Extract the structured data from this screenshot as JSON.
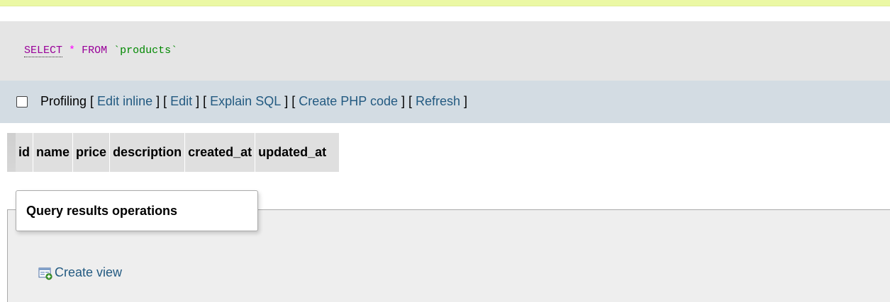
{
  "sql_query": {
    "select_keyword": "SELECT",
    "star": "*",
    "from_keyword": "FROM",
    "table_name": "`products`"
  },
  "toolbar": {
    "profiling_label": "Profiling",
    "profiling_checked": false,
    "links": [
      "Edit inline",
      "Edit",
      "Explain SQL",
      "Create PHP code",
      "Refresh"
    ]
  },
  "results": {
    "columns": [
      "id",
      "name",
      "price",
      "description",
      "created_at",
      "updated_at"
    ]
  },
  "operations": {
    "legend": "Query results operations",
    "create_view_label": "Create view",
    "create_view_icon": "create-view-icon"
  },
  "colors": {
    "banner": "#ebf8a4",
    "sql_bg": "#e5e5e5",
    "toolbar_bg": "#d3dce3",
    "link": "#235a81",
    "sql_keyword": "#990099",
    "sql_star": "#ff00ff",
    "sql_table": "#008800"
  }
}
